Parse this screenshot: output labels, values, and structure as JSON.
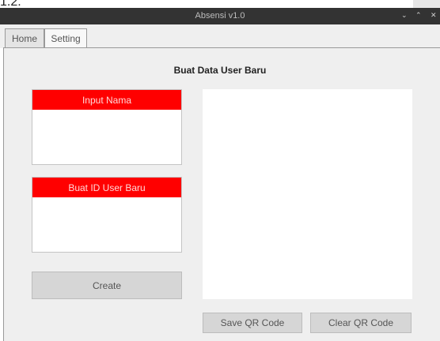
{
  "corner_text": "1.2.",
  "window": {
    "title": "Absensi v1.0",
    "controls": {
      "minimize": "⌄",
      "maximize": "⌃",
      "close": "✕"
    }
  },
  "tabs": [
    {
      "label": "Home",
      "active": false
    },
    {
      "label": "Setting",
      "active": true
    }
  ],
  "setting": {
    "heading": "Buat Data User Baru",
    "nama_label": "Input Nama",
    "nama_value": "",
    "id_label": "Buat ID User Baru",
    "id_value": "",
    "create_label": "Create",
    "save_qr_label": "Save QR Code",
    "clear_qr_label": "Clear QR Code"
  },
  "colors": {
    "accent_red": "#ff0000",
    "titlebar": "#333333",
    "panel_bg": "#efefef"
  }
}
